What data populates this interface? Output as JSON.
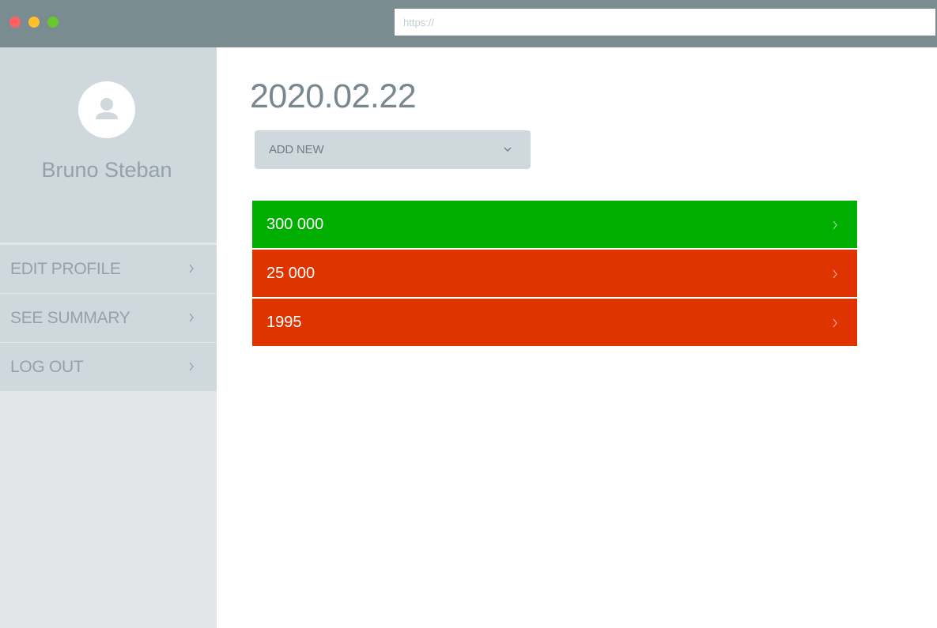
{
  "browser": {
    "url_placeholder": "https://"
  },
  "sidebar": {
    "user_name": "Bruno Steban",
    "avatar_icon": "user-icon",
    "menu": [
      {
        "label": "EDIT PROFILE",
        "icon": "chevron-right-icon"
      },
      {
        "label": "SEE SUMMARY",
        "icon": "chevron-right-icon"
      },
      {
        "label": "LOG OUT",
        "icon": "chevron-right-icon"
      }
    ]
  },
  "main": {
    "date_title": "2020.02.22",
    "add_new": {
      "label": "ADD NEW",
      "icon": "chevron-down-icon"
    },
    "entries": [
      {
        "value": "300 000",
        "status": "positive",
        "color": "#00ae00"
      },
      {
        "value": "25 000",
        "status": "negative",
        "color": "#e03400"
      },
      {
        "value": "1995",
        "status": "negative",
        "color": "#e03400"
      }
    ]
  },
  "colors": {
    "chrome": "#7b8c91",
    "sidebar_panel": "#cfd8dd",
    "sidebar_bg": "#e4e5e7",
    "positive": "#00ae00",
    "negative": "#e03400"
  }
}
